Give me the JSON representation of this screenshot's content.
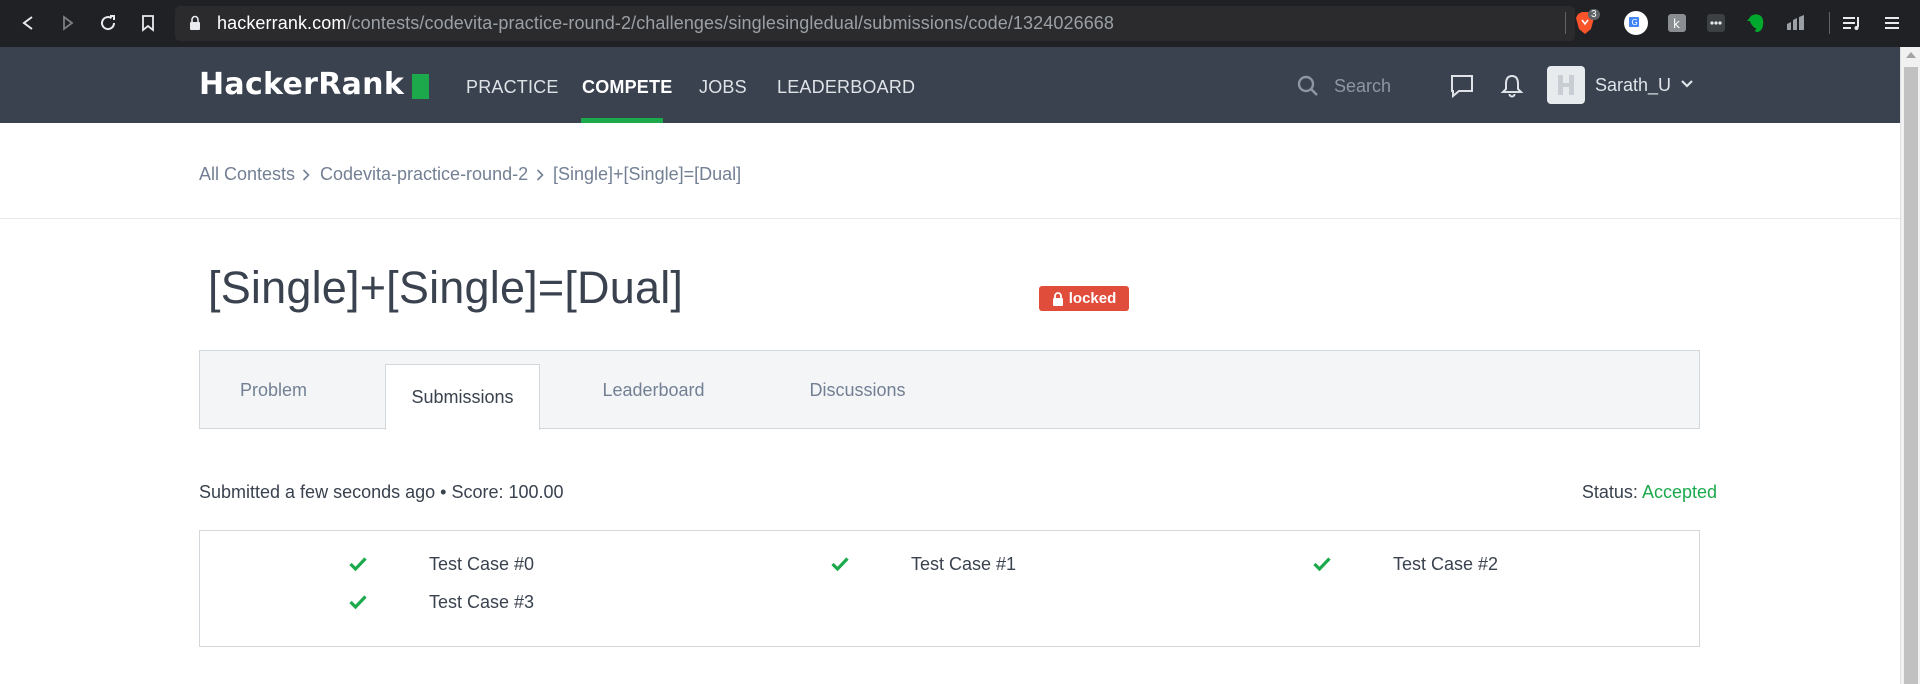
{
  "browser": {
    "url_host": "hackerrank.com",
    "url_path": "/contests/codevita-practice-round-2/challenges/singlesingledual/submissions/code/1324026668",
    "brave_badge_count": "3"
  },
  "nav": {
    "logo": "HackerRank",
    "links": [
      "PRACTICE",
      "COMPETE",
      "JOBS",
      "LEADERBOARD"
    ],
    "active_link": "COMPETE",
    "search_placeholder": "Search",
    "username": "Sarath_U",
    "accent_color": "#1ba94c"
  },
  "breadcrumb": [
    "All Contests",
    "Codevita-practice-round-2",
    "[Single]+[Single]=[Dual]"
  ],
  "challenge": {
    "title": "[Single]+[Single]=[Dual]",
    "badge": "locked"
  },
  "tabs": [
    "Problem",
    "Submissions",
    "Leaderboard",
    "Discussions"
  ],
  "active_tab": "Submissions",
  "submission": {
    "summary": "Submitted a few seconds ago • Score: 100.00",
    "status_label": "Status:",
    "status_value": "Accepted"
  },
  "test_cases": [
    "Test Case #0",
    "Test Case #1",
    "Test Case #2",
    "Test Case #3"
  ]
}
